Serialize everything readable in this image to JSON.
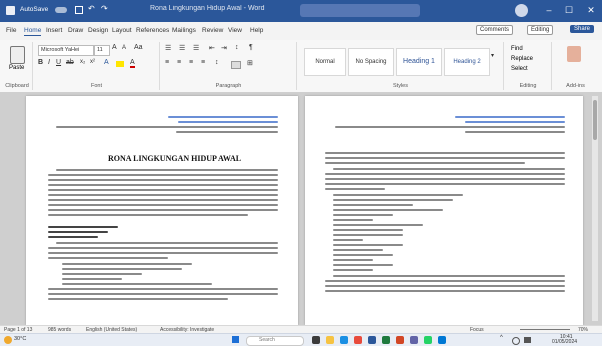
{
  "titlebar": {
    "autosave": "AutoSave",
    "document_title": "Rona Lingkungan Hidup Awal - Word"
  },
  "tabs": [
    "File",
    "Home",
    "Insert",
    "Draw",
    "Design",
    "Layout",
    "References",
    "Mailings",
    "Review",
    "View",
    "Help"
  ],
  "tabs_right": {
    "comments": "Comments",
    "editing": "Editing",
    "share": "Share"
  },
  "ribbon": {
    "clipboard": {
      "paste": "Paste",
      "label": "Clipboard"
    },
    "font": {
      "name": "Microsoft YaHei",
      "size": "11",
      "label": "Font"
    },
    "paragraph": {
      "label": "Paragraph"
    },
    "styles": {
      "items": [
        "Normal",
        "No Spacing",
        "Heading 1",
        "Heading 2"
      ],
      "label": "Styles"
    },
    "editing": {
      "find": "Find",
      "replace": "Replace",
      "select": "Select",
      "label": "Editing"
    },
    "addins": {
      "label": "Add-ins"
    }
  },
  "page_left": {
    "header": "RONA LINGKUNGAN HIDUP AWAL"
  },
  "status": {
    "page": "Page 1 of 13",
    "words": "985 words",
    "language": "English (United States)",
    "accessibility": "Accessibility: Investigate",
    "focus": "Focus",
    "zoom": "70%"
  },
  "taskbar": {
    "weather": "30°C",
    "search_placeholder": "Search",
    "time": "10:41",
    "date": "01/05/2024"
  }
}
